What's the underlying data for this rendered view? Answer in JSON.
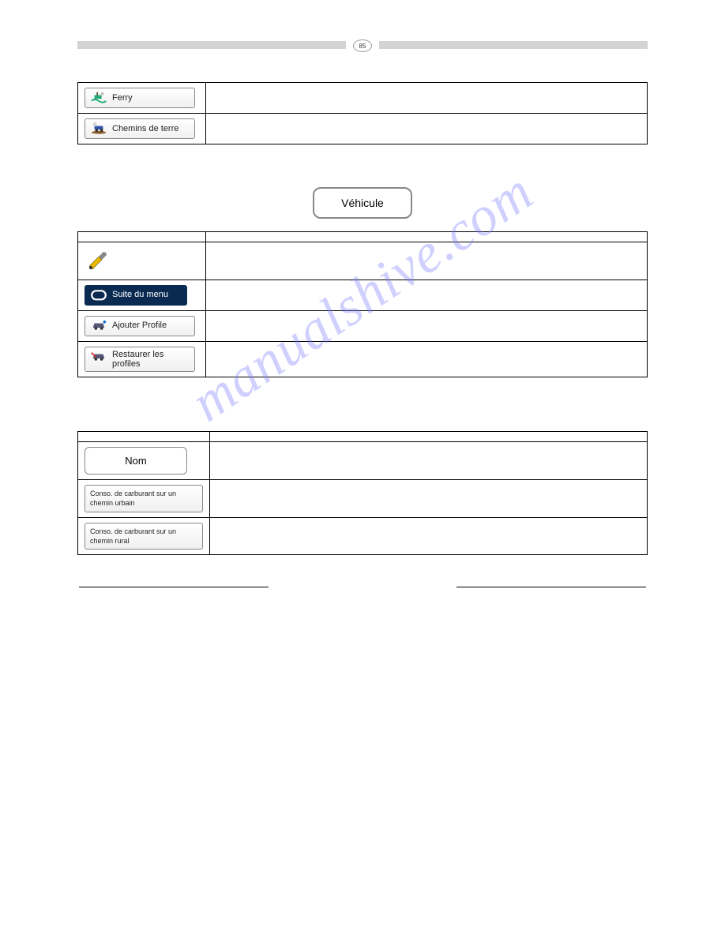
{
  "page_number": "85",
  "watermark": "manualshive.com",
  "table1": {
    "rows": [
      {
        "label": "Ferry",
        "icon": "ferry",
        "desc": ""
      },
      {
        "label": "Chemins de terre",
        "icon": "dirt",
        "desc": ""
      }
    ]
  },
  "section2": {
    "heading": "",
    "intro1": "",
    "pill": "Véhicule",
    "intro2": "",
    "table_hdr_btn": "",
    "table_hdr_desc": "",
    "rows": [
      {
        "kind": "icon-only",
        "icon": "tools",
        "desc": ""
      },
      {
        "kind": "dark",
        "label": "Suite du menu",
        "icon": "loop",
        "desc": ""
      },
      {
        "kind": "light",
        "label": "Ajouter Profile",
        "icon": "car-plus",
        "desc": ""
      },
      {
        "kind": "light-multi",
        "label1": "Restaurer les",
        "label2": "profiles",
        "icon": "car-wrench",
        "desc": ""
      }
    ],
    "outro": ""
  },
  "section3": {
    "intro": "",
    "table_hdr_btn": "",
    "table_hdr_desc": "",
    "rows": [
      {
        "label": "Nom",
        "desc": ""
      },
      {
        "label": "Conso. de carburant sur un chemin urbain",
        "desc": ""
      },
      {
        "label": "Conso. de carburant sur un chemin rural",
        "desc": ""
      }
    ]
  },
  "footer_left": "",
  "footer_right": ""
}
